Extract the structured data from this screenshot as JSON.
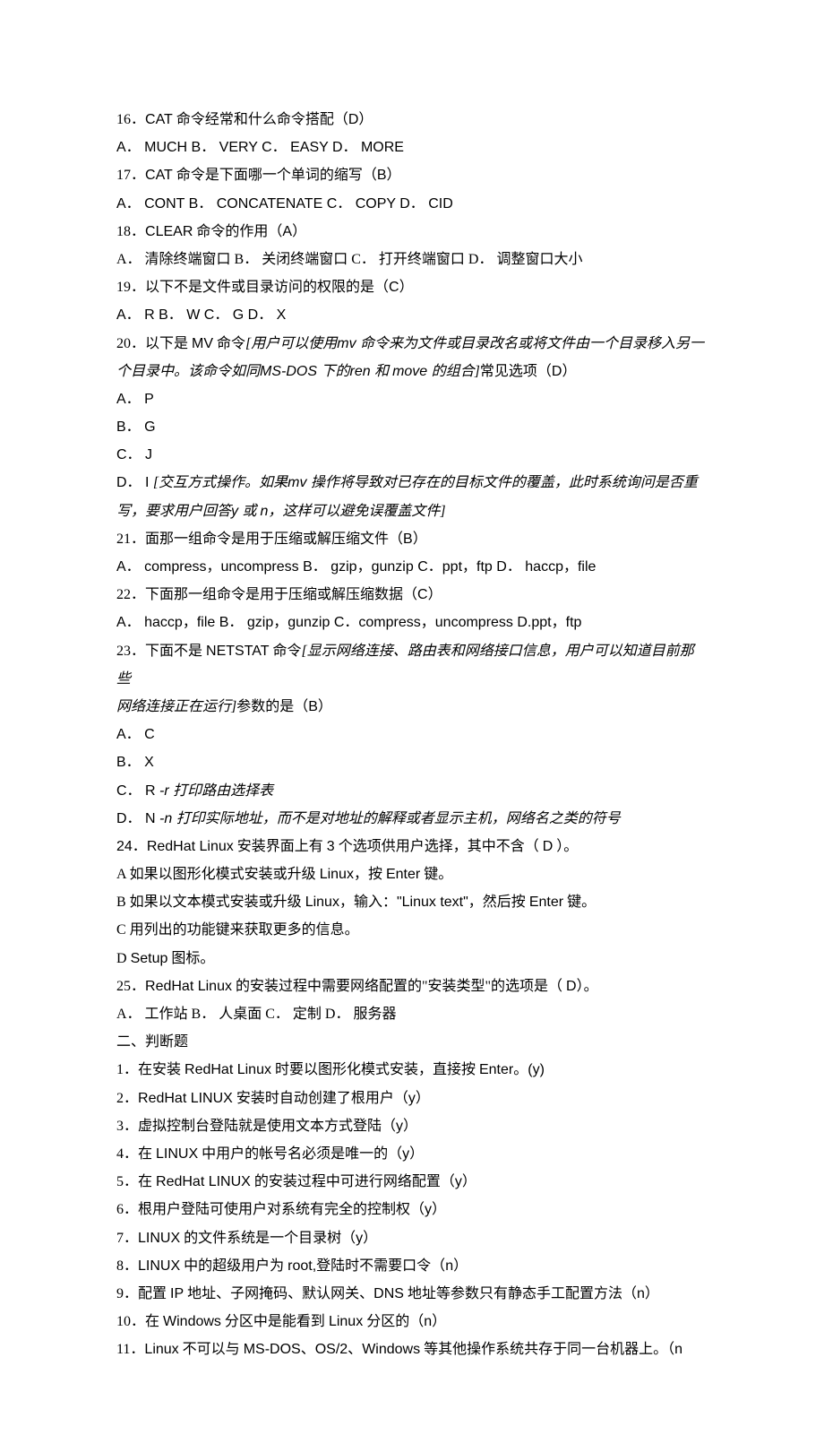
{
  "lines": [
    {
      "parts": [
        {
          "text": "16．"
        },
        {
          "text": "CAT",
          "latin": true
        },
        {
          "text": " 命令经常和什么命令搭配（"
        },
        {
          "text": "D",
          "latin": true
        },
        {
          "text": "）"
        }
      ]
    },
    {
      "parts": [
        {
          "text": "A．  MUCH            B．  VERY       C．  EASY        D．  MORE",
          "latin": true
        }
      ]
    },
    {
      "parts": [
        {
          "text": "17．"
        },
        {
          "text": "CAT",
          "latin": true
        },
        {
          "text": " 命令是下面哪一个单词的缩写（"
        },
        {
          "text": "B",
          "latin": true
        },
        {
          "text": "）"
        }
      ]
    },
    {
      "parts": [
        {
          "text": "A．  CONT        B．  CONCATENATE      C．  COPY        D．  CID",
          "latin": true
        }
      ]
    },
    {
      "parts": [
        {
          "text": "18．"
        },
        {
          "text": "CLEAR",
          "latin": true
        },
        {
          "text": " 命令的作用（"
        },
        {
          "text": "A",
          "latin": true
        },
        {
          "text": "）"
        }
      ]
    },
    {
      "parts": [
        {
          "text": "A．  清除终端窗口          B．  关闭终端窗口       C．  打开终端窗口       D．  调整窗口大小"
        }
      ]
    },
    {
      "parts": [
        {
          "text": "19．以下不是文件或目录访问的权限的是（"
        },
        {
          "text": "C",
          "latin": true
        },
        {
          "text": "）"
        }
      ]
    },
    {
      "parts": [
        {
          "text": "A．  R         B．  W         C．  G        D．  X",
          "latin": true
        }
      ]
    },
    {
      "parts": [
        {
          "text": "20．以下是 "
        },
        {
          "text": "MV",
          "latin": true
        },
        {
          "text": " 命令"
        },
        {
          "text": "[用户可以使用",
          "italic": true
        },
        {
          "text": "mv ",
          "italic": true,
          "latin": true
        },
        {
          "text": "命令来为文件或目录改名或将文件由一个目录移入另一",
          "italic": true
        }
      ]
    },
    {
      "parts": [
        {
          "text": "个目录中。该命令如同",
          "italic": true
        },
        {
          "text": "MS-DOS ",
          "italic": true,
          "latin": true
        },
        {
          "text": "下的",
          "italic": true
        },
        {
          "text": "ren  ",
          "italic": true,
          "latin": true
        },
        {
          "text": "和 ",
          "italic": true
        },
        {
          "text": "move ",
          "italic": true,
          "latin": true
        },
        {
          "text": "的组合]",
          "italic": true
        },
        {
          "text": "常见选项（"
        },
        {
          "text": "D",
          "latin": true
        },
        {
          "text": "）"
        }
      ]
    },
    {
      "parts": [
        {
          "text": "A．  P",
          "latin": true
        }
      ]
    },
    {
      "parts": [
        {
          "text": "B．  G",
          "latin": true
        }
      ]
    },
    {
      "parts": [
        {
          "text": "C．  J",
          "latin": true
        }
      ]
    },
    {
      "parts": [
        {
          "text": "D．  I ",
          "latin": true
        },
        {
          "text": "[交互方式操作。如果",
          "italic": true
        },
        {
          "text": "mv ",
          "italic": true,
          "latin": true
        },
        {
          "text": "操作将导致对已存在的目标文件的覆盖，此时系统询问是否重",
          "italic": true
        }
      ]
    },
    {
      "parts": [
        {
          "text": "写，要求用户回答",
          "italic": true
        },
        {
          "text": "y ",
          "italic": true,
          "latin": true
        },
        {
          "text": "或 ",
          "italic": true
        },
        {
          "text": "n",
          "italic": true,
          "latin": true
        },
        {
          "text": "，这样可以避免误覆盖文件]",
          "italic": true
        }
      ]
    },
    {
      "parts": [
        {
          "text": "21．面那一组命令是用于压缩或解压缩文件（"
        },
        {
          "text": "B",
          "latin": true
        },
        {
          "text": "）"
        }
      ]
    },
    {
      "parts": [
        {
          "text": "A．  compress",
          "latin": true
        },
        {
          "text": "，"
        },
        {
          "text": "uncompress      B．  gzip",
          "latin": true
        },
        {
          "text": "，"
        },
        {
          "text": "gunzip      C",
          "latin": true
        },
        {
          "text": "．"
        },
        {
          "text": "ppt",
          "latin": true
        },
        {
          "text": "，"
        },
        {
          "text": "ftp    D．  haccp",
          "latin": true
        },
        {
          "text": "，"
        },
        {
          "text": "file",
          "latin": true
        }
      ]
    },
    {
      "parts": [
        {
          "text": "22．下面那一组命令是用于压缩或解压缩数据（"
        },
        {
          "text": "C",
          "latin": true
        },
        {
          "text": "）"
        }
      ]
    },
    {
      "parts": [
        {
          "text": "A．  haccp",
          "latin": true
        },
        {
          "text": "，"
        },
        {
          "text": "file        B．  gzip",
          "latin": true
        },
        {
          "text": "，"
        },
        {
          "text": "gunzip      C",
          "latin": true
        },
        {
          "text": "．"
        },
        {
          "text": "compress",
          "latin": true
        },
        {
          "text": "，"
        },
        {
          "text": "uncompress  D.ppt",
          "latin": true
        },
        {
          "text": "，"
        },
        {
          "text": "ftp",
          "latin": true
        }
      ]
    },
    {
      "parts": [
        {
          "text": "23．下面不是 "
        },
        {
          "text": "NETSTAT",
          "latin": true
        },
        {
          "text": " 命令"
        },
        {
          "text": "[显示网络连接、路由表和网络接口信息，用户可以知道目前那些",
          "italic": true
        }
      ]
    },
    {
      "parts": [
        {
          "text": "网络连接正在运行]",
          "italic": true
        },
        {
          "text": "参数的是（"
        },
        {
          "text": "B",
          "latin": true
        },
        {
          "text": "）"
        }
      ]
    },
    {
      "parts": [
        {
          "text": "A．  C",
          "latin": true
        }
      ]
    },
    {
      "parts": [
        {
          "text": "B．  X",
          "latin": true
        }
      ]
    },
    {
      "parts": [
        {
          "text": "C．  R   ",
          "latin": true
        },
        {
          "text": "-r ",
          "italic": true,
          "latin": true
        },
        {
          "text": "打印路由选择表",
          "italic": true
        }
      ]
    },
    {
      "parts": [
        {
          "text": "D．  N    ",
          "latin": true
        },
        {
          "text": "-n ",
          "italic": true,
          "latin": true
        },
        {
          "text": "打印实际地址，而不是对地址的解释或者显示主机，网络名之类的符号",
          "italic": true
        }
      ]
    },
    {
      "parts": [
        {
          "text": "24",
          "latin": true
        },
        {
          "text": "．"
        },
        {
          "text": "RedHat Linux",
          "latin": true
        },
        {
          "text": " 安装界面上有 "
        },
        {
          "text": "3",
          "latin": true
        },
        {
          "text": " 个选项供用户选择，其中不含（    "
        },
        {
          "text": "D",
          "latin": true
        },
        {
          "text": "  ）。"
        }
      ]
    },
    {
      "parts": [
        {
          "text": "A 如果以图形化模式安装或升级 "
        },
        {
          "text": "Linux",
          "latin": true
        },
        {
          "text": "，按 "
        },
        {
          "text": "Enter",
          "latin": true
        },
        {
          "text": " 键。"
        }
      ]
    },
    {
      "parts": [
        {
          "text": "B 如果以文本模式安装或升级 "
        },
        {
          "text": "Linux",
          "latin": true
        },
        {
          "text": "，输入："
        },
        {
          "text": "\"Linux text\"",
          "latin": true
        },
        {
          "text": "，然后按 "
        },
        {
          "text": "Enter",
          "latin": true
        },
        {
          "text": " 键。"
        }
      ]
    },
    {
      "parts": [
        {
          "text": "C 用列出的功能键来获取更多的信息。"
        }
      ]
    },
    {
      "parts": [
        {
          "text": "D "
        },
        {
          "text": "Setup",
          "latin": true
        },
        {
          "text": " 图标。"
        }
      ]
    },
    {
      "parts": [
        {
          "text": "25．"
        },
        {
          "text": "RedHat Linux",
          "latin": true
        },
        {
          "text": " 的安装过程中需要网络配置的\"安装类型\"的选项是（ "
        },
        {
          "text": "D",
          "latin": true
        },
        {
          "text": "）。"
        }
      ]
    },
    {
      "parts": [
        {
          "text": "A．   工作站     B．   人桌面        C．   定制          D．   服务器"
        }
      ]
    },
    {
      "parts": [
        {
          "text": "二、判断题"
        }
      ]
    },
    {
      "parts": [
        {
          "text": "1．在安装 "
        },
        {
          "text": "RedHat Linux",
          "latin": true
        },
        {
          "text": " 时要以图形化模式安装，直接按 "
        },
        {
          "text": "Enter",
          "latin": true
        },
        {
          "text": "。"
        },
        {
          "text": "(y)",
          "latin": true
        }
      ]
    },
    {
      "parts": [
        {
          "text": "2．"
        },
        {
          "text": "RedHat LINUX",
          "latin": true
        },
        {
          "text": " 安装时自动创建了根用户（"
        },
        {
          "text": "y",
          "latin": true
        },
        {
          "text": "）"
        }
      ]
    },
    {
      "parts": [
        {
          "text": "3．虚拟控制台登陆就是使用文本方式登陆（"
        },
        {
          "text": "y",
          "latin": true
        },
        {
          "text": "）"
        }
      ]
    },
    {
      "parts": [
        {
          "text": "4．在 "
        },
        {
          "text": "LINUX",
          "latin": true
        },
        {
          "text": " 中用户的帐号名必须是唯一的（"
        },
        {
          "text": "y",
          "latin": true
        },
        {
          "text": "）"
        }
      ]
    },
    {
      "parts": [
        {
          "text": "5．在 "
        },
        {
          "text": "RedHat LINUX",
          "latin": true
        },
        {
          "text": " 的安装过程中可进行网络配置（"
        },
        {
          "text": "y",
          "latin": true
        },
        {
          "text": "）"
        }
      ]
    },
    {
      "parts": [
        {
          "text": "6．根用户登陆可使用户对系统有完全的控制权（"
        },
        {
          "text": "y",
          "latin": true
        },
        {
          "text": "）"
        }
      ]
    },
    {
      "parts": [
        {
          "text": "7．"
        },
        {
          "text": "LINUX",
          "latin": true
        },
        {
          "text": " 的文件系统是一个目录树（"
        },
        {
          "text": "y",
          "latin": true
        },
        {
          "text": "）"
        }
      ]
    },
    {
      "parts": [
        {
          "text": "8．"
        },
        {
          "text": "LINUX",
          "latin": true
        },
        {
          "text": " 中的超级用户为 "
        },
        {
          "text": "root,",
          "latin": true
        },
        {
          "text": "登陆时不需要口令（"
        },
        {
          "text": "n",
          "latin": true
        },
        {
          "text": "）"
        }
      ]
    },
    {
      "parts": [
        {
          "text": "9．配置 "
        },
        {
          "text": "IP",
          "latin": true
        },
        {
          "text": " 地址、子网掩码、默认网关、"
        },
        {
          "text": "DNS",
          "latin": true
        },
        {
          "text": " 地址等参数只有静态手工配置方法（"
        },
        {
          "text": "n",
          "latin": true
        },
        {
          "text": "）"
        }
      ]
    },
    {
      "parts": [
        {
          "text": "10．在 "
        },
        {
          "text": "Windows",
          "latin": true
        },
        {
          "text": " 分区中是能看到 "
        },
        {
          "text": "Linux",
          "latin": true
        },
        {
          "text": " 分区的（"
        },
        {
          "text": "n",
          "latin": true
        },
        {
          "text": "）"
        }
      ]
    },
    {
      "parts": [
        {
          "text": "11．"
        },
        {
          "text": "Linux",
          "latin": true
        },
        {
          "text": " 不可以与 "
        },
        {
          "text": "MS-DOS",
          "latin": true
        },
        {
          "text": "、"
        },
        {
          "text": "OS/2",
          "latin": true
        },
        {
          "text": "、"
        },
        {
          "text": "Windows",
          "latin": true
        },
        {
          "text": " 等其他操作系统共存于同一台机器上。（"
        },
        {
          "text": "n",
          "latin": true
        }
      ]
    }
  ]
}
